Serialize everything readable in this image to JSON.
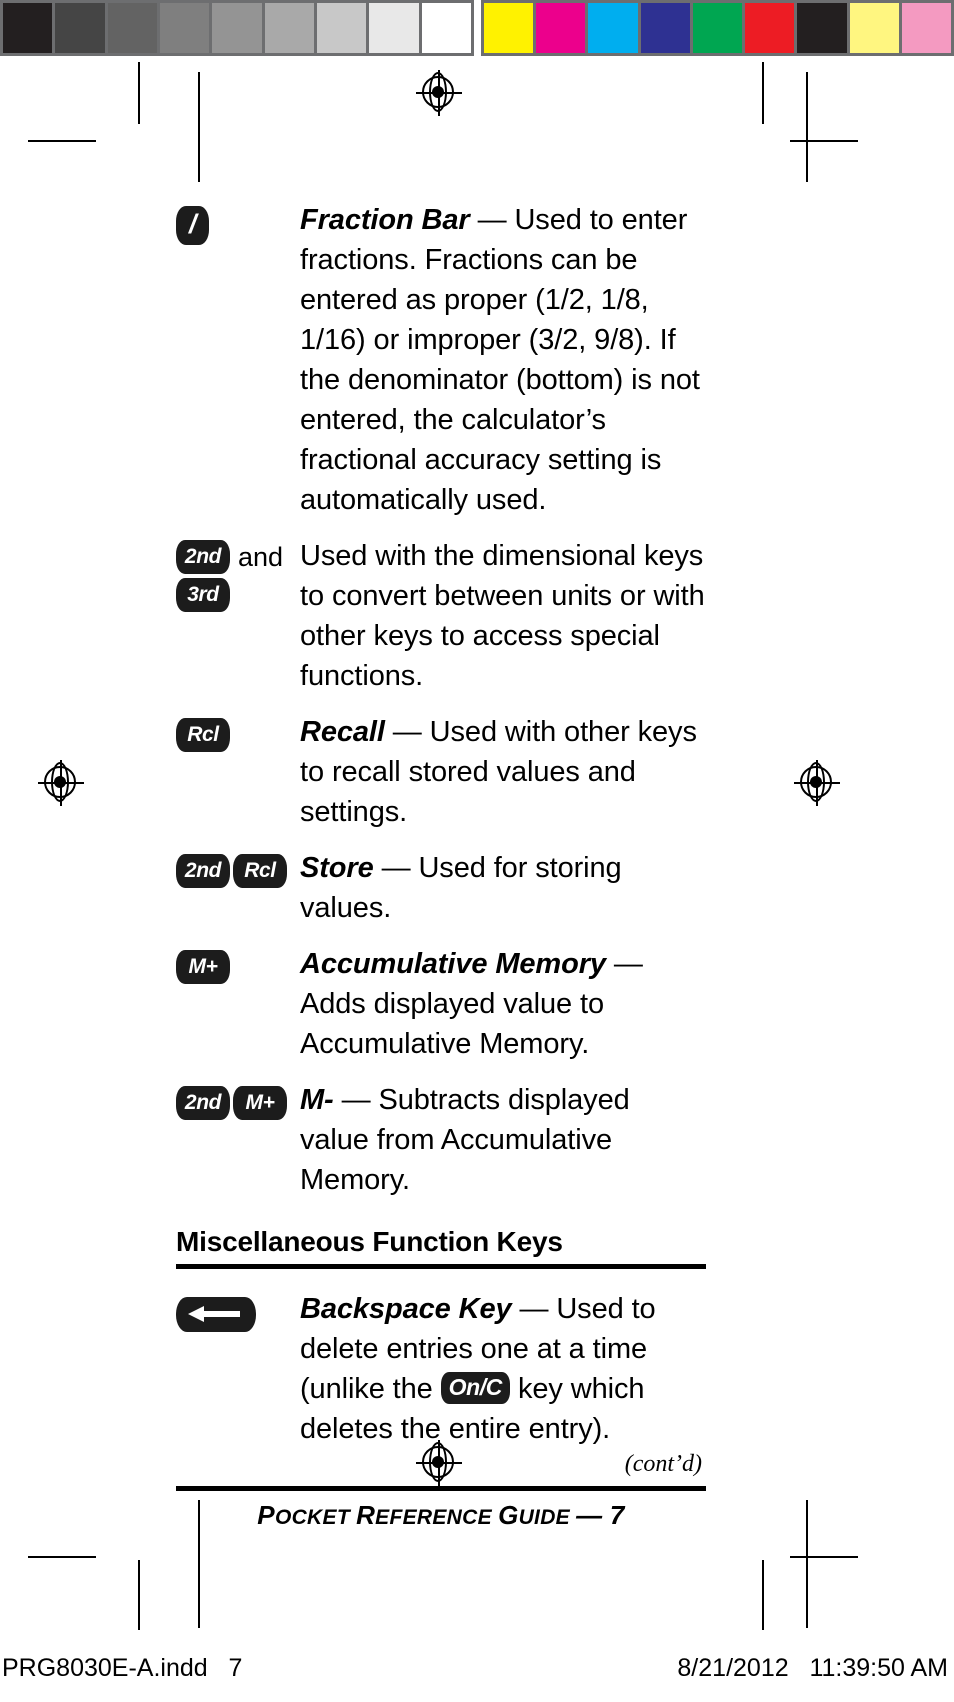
{
  "calibration": {
    "gray_swatches": [
      "#231f20",
      "#454545",
      "#636363",
      "#7f7f7f",
      "#949494",
      "#a9a9a9",
      "#c8c8c8",
      "#e8e8e8",
      "#ffffff"
    ],
    "color_swatches": [
      "#fff200",
      "#ec008c",
      "#00aeef",
      "#2e3192",
      "#00a651",
      "#ed1c24",
      "#231f20",
      "#fff680",
      "#f49ac1"
    ]
  },
  "entries": [
    {
      "keys": [
        "/"
      ],
      "key_style": "slash",
      "term": "Fraction Bar",
      "dash": " — ",
      "body": "Used to enter fractions. Fractions can be entered as proper (1/2, 1/8, 1/16) or improper (3/2, 9/8). If the denominator (bottom) is not entered, the calculator’s fractional accuracy setting is automatically used."
    },
    {
      "keys": [
        "2nd",
        "3rd"
      ],
      "joiner": "and",
      "key_style": "stacked",
      "term": "",
      "dash": "",
      "body": "Used with the dimensional keys to convert between units or with other keys to access special functions."
    },
    {
      "keys": [
        "Rcl"
      ],
      "key_style": "single",
      "term": "Recall",
      "dash": " — ",
      "body": "Used with other keys to recall stored values and settings."
    },
    {
      "keys": [
        "2nd",
        "Rcl"
      ],
      "key_style": "pair",
      "term": "Store",
      "dash": " — ",
      "body": "Used for storing values."
    },
    {
      "keys": [
        "M+"
      ],
      "key_style": "single",
      "term": "Accumulative Memory",
      "dash": " — ",
      "body": "Adds displayed value to Accumulative Memory."
    },
    {
      "keys": [
        "2nd",
        "M+"
      ],
      "key_style": "pair",
      "term": "M-",
      "dash": " — ",
      "body": "Subtracts displayed value from Accumulative Memory."
    }
  ],
  "section": {
    "heading": "Miscellaneous Function Keys"
  },
  "backspace_entry": {
    "key_icon": "backspace-arrow-icon",
    "term": "Backspace Key",
    "dash": " — ",
    "body_before": "Used to delete entries one at a time (unlike the ",
    "inline_key": "On/C",
    "body_after": " key which deletes the entire entry)."
  },
  "continued_note": "(cont’d)",
  "footer": {
    "text_parts": {
      "p1": "P",
      "p2": "OCKET ",
      "p3": "R",
      "p4": "EFERENCE ",
      "p5": "G",
      "p6": "UIDE ",
      "p7": "— 7"
    },
    "full_text": "POCKET REFERENCE GUIDE — 7"
  },
  "slug": {
    "file_name": "PRG8030E-A.indd   7",
    "timestamp": "8/21/2012   11:39:50 AM"
  },
  "colors": {
    "key_black": "#1c1c1c",
    "ink": "#000000",
    "paper": "#ffffff",
    "calib_frame": "#6d6e70"
  }
}
